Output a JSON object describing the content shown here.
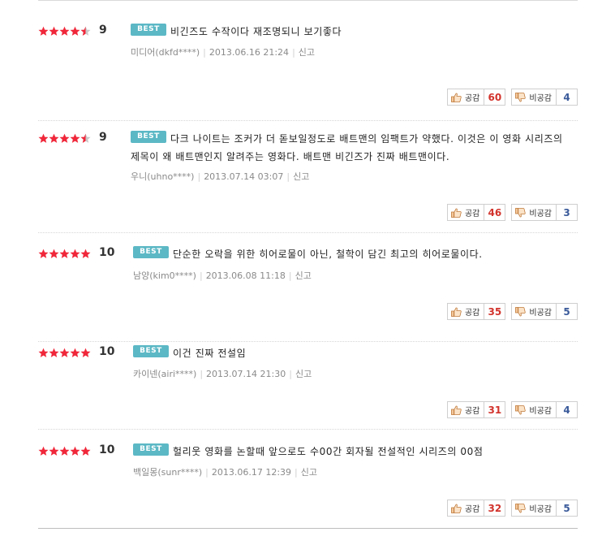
{
  "colors": {
    "star_filled": "#f0273a",
    "star_empty": "#c9c9c9",
    "best_badge": "#5cb8c5",
    "like_count": "#d2332c",
    "dislike_count": "#3a5a9a"
  },
  "icons": {
    "star": "star-icon",
    "like": "thumbs-up-icon",
    "dislike": "thumbs-down-icon"
  },
  "labels": {
    "best": "BEST",
    "like": "공감",
    "dislike": "비공감",
    "report": "신고"
  },
  "reviews": [
    {
      "rating": 9,
      "score": "9",
      "comment": "비긴즈도 수작이다 재조명되니 보기좋다",
      "author": "미디어(dkfd****)",
      "date": "2013.06.16 21:24",
      "likes": "60",
      "dislikes": "4"
    },
    {
      "rating": 9,
      "score": "9",
      "comment": "다크 나이트는 조커가 더 돋보일정도로 배트맨의 임팩트가 약했다. 이것은 이 영화 시리즈의 제목이 왜 배트맨인지 알려주는 영화다. 배트맨 비긴즈가 진짜 배트맨이다.",
      "author": "우니(uhno****)",
      "date": "2013.07.14 03:07",
      "likes": "46",
      "dislikes": "3"
    },
    {
      "rating": 10,
      "score": "10",
      "comment": "단순한 오락을 위한 히어로물이 아닌, 철학이 담긴 최고의 히어로물이다.",
      "author": "남양(kim0****)",
      "date": "2013.06.08 11:18",
      "likes": "35",
      "dislikes": "5"
    },
    {
      "rating": 10,
      "score": "10",
      "comment": "이건 진짜 전설임",
      "author": "카이넨(airi****)",
      "date": "2013.07.14 21:30",
      "likes": "31",
      "dislikes": "4"
    },
    {
      "rating": 10,
      "score": "10",
      "comment": "헐리웃 영화를 논할때 앞으로도 수00간 회자될 전설적인 시리즈의 00점",
      "author": "백일몽(sunr****)",
      "date": "2013.06.17 12:39",
      "likes": "32",
      "dislikes": "5"
    }
  ]
}
